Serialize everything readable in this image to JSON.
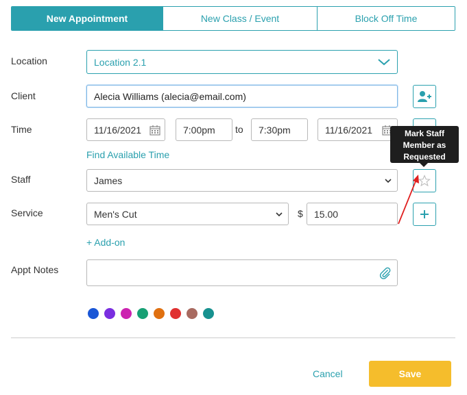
{
  "tabs": [
    {
      "label": "New Appointment",
      "active": true
    },
    {
      "label": "New Class / Event",
      "active": false
    },
    {
      "label": "Block Off Time",
      "active": false
    }
  ],
  "form": {
    "location": {
      "label": "Location",
      "value": "Location 2.1"
    },
    "client": {
      "label": "Client",
      "value": "Alecia Williams (alecia@email.com)"
    },
    "time": {
      "label": "Time",
      "start_date": "11/16/2021",
      "start_time": "7:00pm",
      "separator": "to",
      "end_time": "7:30pm",
      "end_date": "11/16/2021",
      "find_available_link": "Find Available Time"
    },
    "staff": {
      "label": "Staff",
      "value": "James"
    },
    "service": {
      "label": "Service",
      "value": "Men's Cut",
      "currency": "$",
      "price": "15.00",
      "addon_link": "+ Add-on"
    },
    "notes": {
      "label": "Appt Notes",
      "value": ""
    }
  },
  "tooltip": {
    "text": "Mark Staff Member as Requested"
  },
  "colors": {
    "accent": "#2aa0ae",
    "save": "#f5bd2c",
    "swatches": [
      "#1a56d6",
      "#7a2ee0",
      "#cc22b0",
      "#17a074",
      "#e07010",
      "#e03030",
      "#a86a60",
      "#17918f"
    ]
  },
  "icons": {
    "location_dropdown": "chevron-down-icon",
    "add_client": "add-user-icon",
    "calendar": "calendar-icon",
    "requested": "star-icon",
    "add_service": "plus-icon",
    "attach": "paperclip-icon"
  },
  "actions": {
    "cancel": "Cancel",
    "save": "Save"
  }
}
